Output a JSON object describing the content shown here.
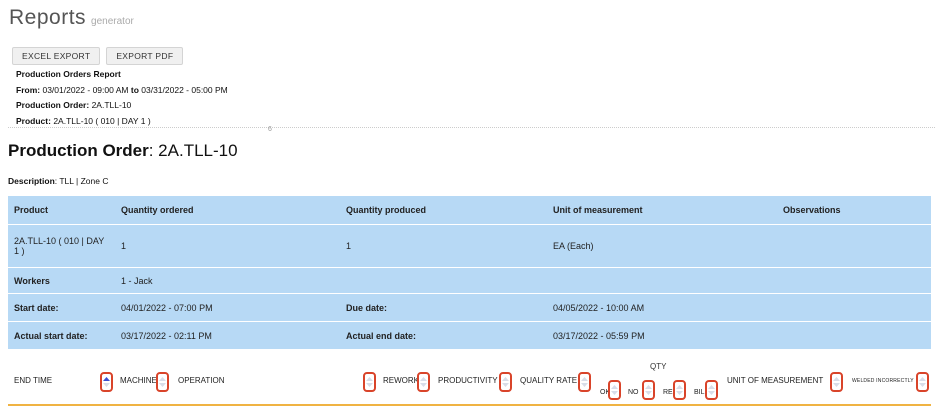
{
  "header": {
    "title": "Reports",
    "subtitle": "generator"
  },
  "toolbar": {
    "excel_export": "EXCEL EXPORT",
    "export_pdf": "EXPORT PDF"
  },
  "report": {
    "name": "Production Orders Report",
    "from_label": "From:",
    "from_value": "03/01/2022 - 09:00 AM",
    "to_label": "to",
    "to_value": "03/31/2022 - 05:00 PM",
    "po_label": "Production Order:",
    "po_value": "2A.TLL-10",
    "product_label": "Product:",
    "product_value": "2A.TLL-10 ( 010 | DAY 1 )"
  },
  "divider_mark": "6",
  "production_order": {
    "title_label": "Production Order",
    "title_value": ": 2A.TLL-10",
    "description_label": "Description",
    "description_value": ": TLL | Zone C"
  },
  "info_table": {
    "headers": {
      "product": "Product",
      "qty_ordered": "Quantity ordered",
      "qty_produced": "Quantity produced",
      "uom": "Unit of measurement",
      "observations": "Observations"
    },
    "row": {
      "product": "2A.TLL-10 ( 010 | DAY 1 )",
      "qty_ordered": "1",
      "qty_produced": "1",
      "uom": "EA (Each)",
      "observations": ""
    },
    "workers_label": "Workers",
    "workers_value": "1 - Jack",
    "start_date_label": "Start date:",
    "start_date_value": "04/01/2022 - 07:00 PM",
    "due_date_label": "Due date:",
    "due_date_value": "04/05/2022 - 10:00 AM",
    "actual_start_label": "Actual start date:",
    "actual_start_value": "03/17/2022 - 02:11 PM",
    "actual_end_label": "Actual end date:",
    "actual_end_value": "03/17/2022 - 05:59 PM"
  },
  "columns": {
    "end_time": "END TIME",
    "machine": "MACHINE",
    "operation": "OPERATION",
    "rework": "REWORK",
    "productivity": "PRODUCTIVITY",
    "quality_rate": "QUALITY RATE",
    "qty": "QTY",
    "qty_ok": "OK",
    "qty_no": "NO",
    "qty_re": "RE",
    "qty_bil": "BIL",
    "uom": "UNIT OF MEASUREMENT",
    "welded": "WELDED INCORRECTLY"
  },
  "colors": {
    "accent_row": "#b7d9f5",
    "sort_highlight": "#d9442a",
    "bottom_rule": "#f0b343"
  }
}
